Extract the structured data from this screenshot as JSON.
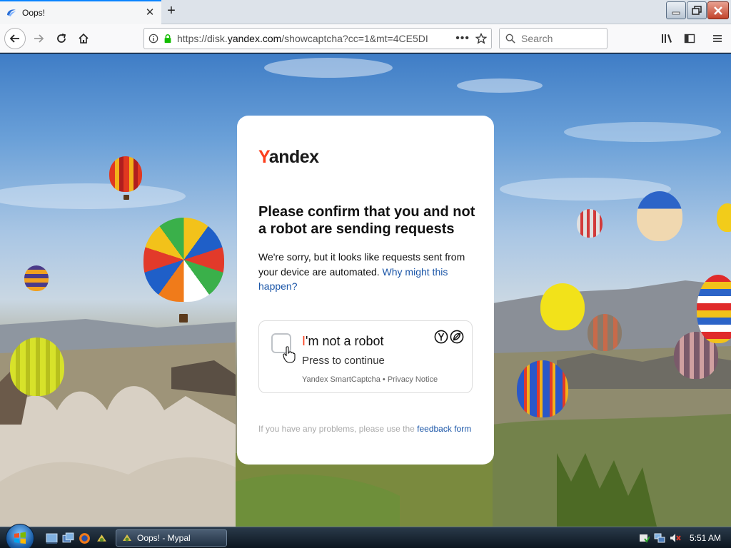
{
  "browser": {
    "tab_title": "Oops!",
    "url_prefix": "https://disk.",
    "url_host": "yandex.com",
    "url_path": "/showcaptcha?cc=1&mt=4CE5DI",
    "search_placeholder": "Search",
    "colors": {
      "accent": "#0a84ff",
      "secure_lock": "#12bc00"
    }
  },
  "captcha": {
    "logo_first": "Y",
    "logo_rest": "andex",
    "title": "Please confirm that you and not a robot are sending requests",
    "description": "We're sorry, but it looks like requests sent from your device are automated.",
    "why_link": "Why might this happen?",
    "robot_label_first": "I",
    "robot_label_rest": "'m not a robot",
    "press_to_continue": "Press to continue",
    "smartcaptcha_line": "Yandex SmartCaptcha • Privacy Notice",
    "footer_text": "If you have any problems, please use the",
    "footer_link": "feedback form",
    "colors": {
      "brand_red": "#fc3f1d",
      "link": "#1b56a8"
    }
  },
  "taskbar": {
    "task_label": "Oops! - Mypal",
    "clock": "5:51 AM"
  }
}
